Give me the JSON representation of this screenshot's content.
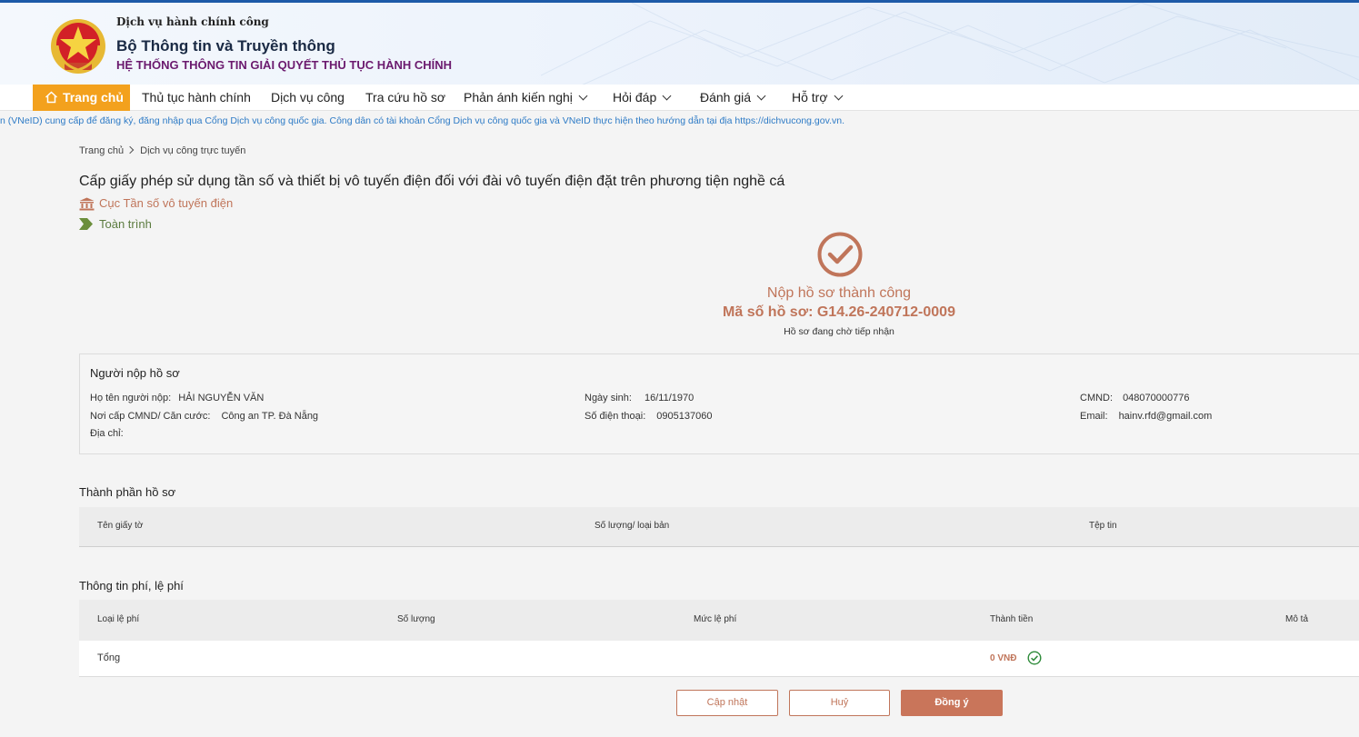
{
  "header": {
    "pretitle": "Dịch vụ hành chính công",
    "title": "Bộ Thông tin và Truyền thông",
    "subtitle": "HỆ THỐNG THÔNG TIN GIẢI QUYẾT THỦ TỤC HÀNH CHÍNH"
  },
  "nav": {
    "home": "Trang chủ",
    "items": [
      "Thủ tục hành chính",
      "Dịch vụ công",
      "Tra cứu hồ sơ",
      "Phản ánh kiến nghị",
      "Hỏi đáp",
      "Đánh giá",
      "Hỗ trợ"
    ]
  },
  "marquee": "n (VNeID) cung cấp để đăng ký, đăng nhập qua Cổng Dịch vụ công quốc gia. Công dân có tài khoản Cổng Dịch vụ công quốc gia và VNeID thực hiện theo hướng dẫn tại địa https://dichvucong.gov.vn.",
  "breadcrumb": [
    "Trang chủ",
    "Dịch vụ công trực tuyến"
  ],
  "procedure": {
    "title": "Cấp giấy phép sử dụng tần số và thiết bị vô tuyến điện đối với đài vô tuyến điện đặt trên phương tiện nghề cá",
    "agency": "Cục Tần số vô tuyến điện",
    "level": "Toàn trình"
  },
  "result": {
    "title": "Nộp hồ sơ thành công",
    "code": "Mã số hồ sơ: G14.26-240712-0009",
    "status": "Hồ sơ đang chờ tiếp nhận"
  },
  "applicant": {
    "section_title": "Người nộp hồ sơ",
    "name_label": "Họ tên người nộp:",
    "name": "HẢI NGUYỄN VĂN",
    "dob_label": "Ngày sinh:",
    "dob": "16/11/1970",
    "id_label": "CMND:",
    "id": "048070000776",
    "issue_label": "Nơi cấp CMND/ Căn cước:",
    "issue": "Công an TP. Đà Nẵng",
    "phone_label": "Số điện thoại:",
    "phone": "0905137060",
    "email_label": "Email:",
    "email": "hainv.rfd@gmail.com",
    "address_label": "Địa chỉ:"
  },
  "documents": {
    "section_title": "Thành phần hồ sơ",
    "columns": [
      "Tên giấy tờ",
      "Số lượng/ loại bản",
      "Tệp tin"
    ]
  },
  "fees": {
    "section_title": "Thông tin phí, lệ phí",
    "columns": [
      "Loại lệ phí",
      "Số lượng",
      "Mức lệ phí",
      "Thành tiền",
      "Mô tả"
    ],
    "total_label": "Tổng",
    "total_value": "0 VNĐ"
  },
  "buttons": {
    "update": "Cập nhật",
    "cancel": "Huỷ",
    "agree": "Đồng ý"
  },
  "colors": {
    "accent": "#c0755a",
    "home_tab": "#f3a11d",
    "link_blue": "#2e7bc6"
  }
}
